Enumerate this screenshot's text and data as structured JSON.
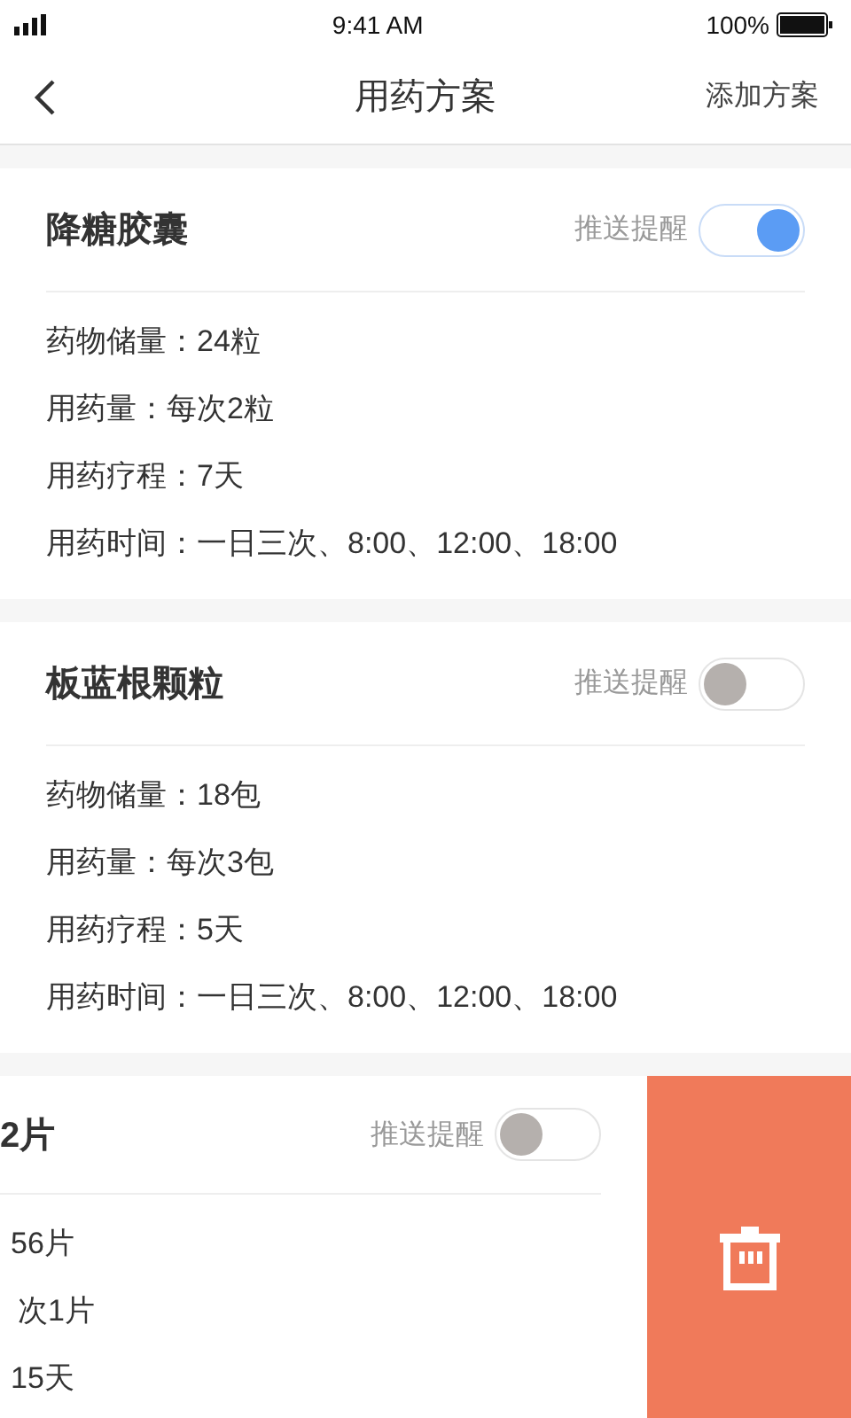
{
  "status_bar": {
    "time": "9:41 AM",
    "battery": "100%"
  },
  "nav": {
    "title": "用药方案",
    "action": "添加方案"
  },
  "plans": [
    {
      "kind": "full",
      "name": "降糖胶囊",
      "reminder_label": "推送提醒",
      "reminder_on": true,
      "details": [
        "药物储量：24粒",
        "用药量：每次2粒",
        "用药疗程：7天",
        "用药时间：一日三次、8:00、12:00、18:00"
      ]
    },
    {
      "kind": "full",
      "name": "板蓝根颗粒",
      "reminder_label": "推送提醒",
      "reminder_on": false,
      "details": [
        "药物储量：18包",
        "用药量：每次3包",
        "用药疗程：5天",
        "用药时间：一日三次、8:00、12:00、18:00"
      ]
    },
    {
      "kind": "swiped",
      "name": "2片",
      "reminder_label": "推送提醒",
      "reminder_on": false,
      "details": [
        "56片",
        "次1片",
        "15天"
      ]
    }
  ]
}
